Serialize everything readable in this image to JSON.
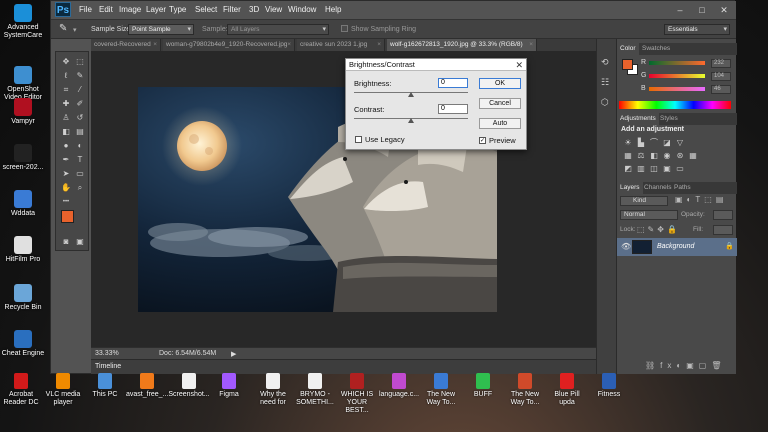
{
  "desktop_left": [
    {
      "label": "Advanced SystemCare",
      "color": "#1b8fd8"
    },
    {
      "label": "OpenShot Video Editor",
      "color": "#3e8fd0"
    },
    {
      "label": "Vampyr",
      "color": "#b01020"
    },
    {
      "label": "screen-202...",
      "color": "#222222"
    },
    {
      "label": "Wddata",
      "color": "#3a7bd5"
    },
    {
      "label": "HitFilm Pro",
      "color": "#e0e0e0"
    },
    {
      "label": "Recycle Bin",
      "color": "#6ba6d8"
    },
    {
      "label": "Cheat Engine",
      "color": "#2a6fbf"
    }
  ],
  "desktop_bottom": [
    {
      "label": "Acrobat Reader DC",
      "color": "#d11a1a"
    },
    {
      "label": "VLC media player",
      "color": "#f08a00"
    },
    {
      "label": "This PC",
      "color": "#4a90d9"
    },
    {
      "label": "avast_free_...",
      "color": "#f07a1a"
    },
    {
      "label": "Screenshot...",
      "color": "#f0f0f0"
    },
    {
      "label": "Figma",
      "color": "#a259ff"
    },
    {
      "label": "Why the need for",
      "color": "#f0f0f0"
    },
    {
      "label": "BRYMO - SOMETHI...",
      "color": "#f0f0f0"
    },
    {
      "label": "WHICH IS YOUR BEST...",
      "color": "#b02020"
    },
    {
      "label": "language.c...",
      "color": "#c04ad0"
    },
    {
      "label": "The New Way To...",
      "color": "#3a7bd5"
    },
    {
      "label": "BUFF",
      "color": "#2fbf4f"
    },
    {
      "label": "The New Way To...",
      "color": "#d04a2a"
    },
    {
      "label": "Blue Pill upda",
      "color": "#e02020"
    },
    {
      "label": "Fitness",
      "color": "#2b5fb5"
    }
  ],
  "photoshop": {
    "logo": "Ps",
    "menu": [
      "File",
      "Edit",
      "Image",
      "Layer",
      "Type",
      "Select",
      "Filter",
      "3D",
      "View",
      "Window",
      "Help"
    ],
    "window_controls": [
      "–",
      "□",
      "✕"
    ],
    "options": {
      "sample_size_label": "Sample Size:",
      "sample_size_value": "Point Sample",
      "sample_label": "Sample:",
      "sample_value": "All Layers",
      "show_ring_label": "Show Sampling Ring",
      "workspace": "Essentials"
    },
    "tabs": [
      {
        "label": "covered-Recovered",
        "active": false
      },
      {
        "label": "woman-g79802b4e9_1920-Recovered.jpg",
        "active": false
      },
      {
        "label": "creative sun 2023 1.jpg",
        "active": false
      },
      {
        "label": "wolf-g162672813_1920.jpg @ 33.3% (RGB/8)",
        "active": true
      }
    ],
    "status": {
      "zoom": "33.33%",
      "doc": "Doc: 6.54M/6.54M"
    },
    "timeline_label": "Timeline",
    "foreground_color": "#e8622c",
    "background_color": "#ffffff"
  },
  "panels": {
    "color_tabs": [
      "Color",
      "Swatches"
    ],
    "channels": [
      {
        "name": "R",
        "value": "232"
      },
      {
        "name": "G",
        "value": "104"
      },
      {
        "name": "B",
        "value": "46"
      }
    ],
    "adjustments_tabs": [
      "Adjustments",
      "Styles"
    ],
    "add_adjustment": "Add an adjustment",
    "layers_tabs": [
      "Layers",
      "Channels",
      "Paths"
    ],
    "kind_label": "Kind",
    "blend_mode": "Normal",
    "opacity_label": "Opacity:",
    "lock_label": "Lock:",
    "fill_label": "Fill:",
    "layer_name": "Background"
  },
  "dialog": {
    "title": "Brightness/Contrast",
    "brightness_label": "Brightness:",
    "brightness_value": "0",
    "contrast_label": "Contrast:",
    "contrast_value": "0",
    "use_legacy": "Use Legacy",
    "ok": "OK",
    "cancel": "Cancel",
    "auto": "Auto",
    "preview": "Preview",
    "preview_checked": true,
    "legacy_checked": false
  }
}
